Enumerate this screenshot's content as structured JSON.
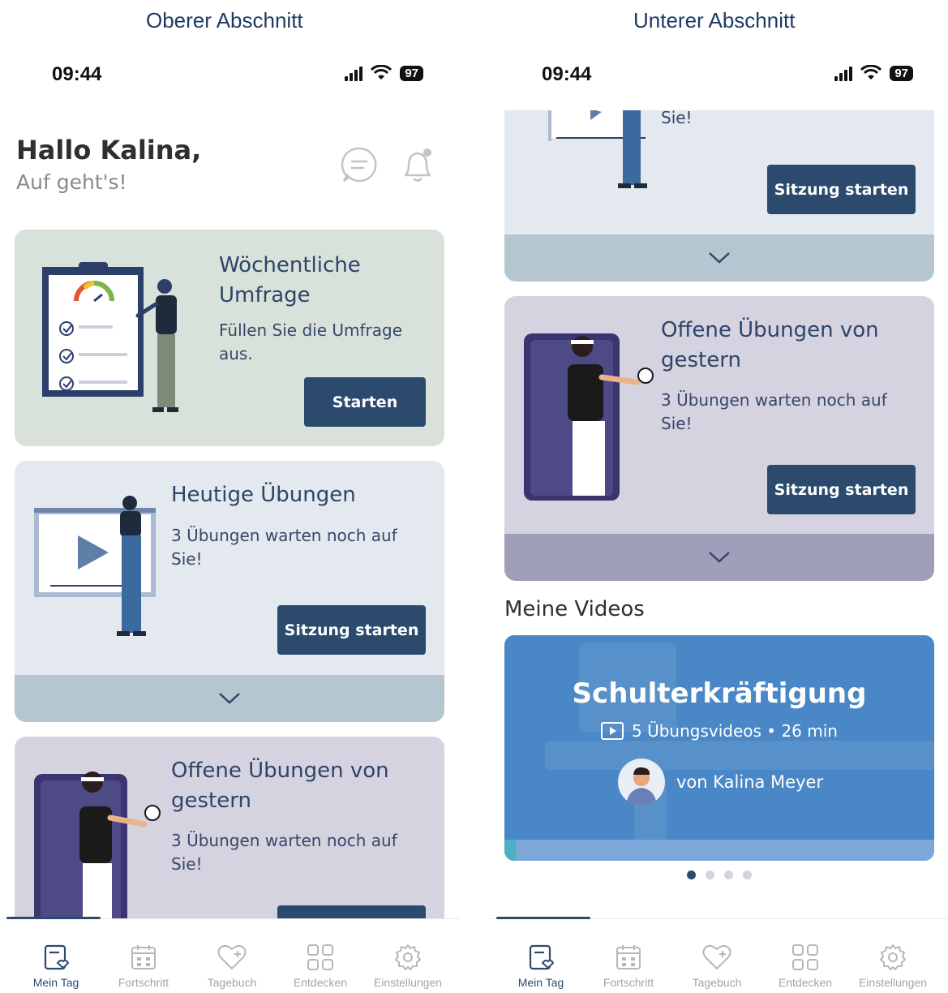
{
  "section_labels": {
    "left": "Oberer Abschnitt",
    "right": "Unterer Abschnitt"
  },
  "status": {
    "time": "09:44",
    "battery": "97"
  },
  "greeting": {
    "title": "Hallo Kalina,",
    "subtitle": "Auf geht's!"
  },
  "survey": {
    "title_line1": "Wöchentliche",
    "title_line2": "Umfrage",
    "desc_line1": "Füllen Sie die Umfrage",
    "desc_line2": "aus.",
    "button": "Starten"
  },
  "today": {
    "title": "Heutige Übungen",
    "desc_line1": "3 Übungen warten noch auf",
    "desc_line2": "Sie!",
    "button": "Sitzung starten"
  },
  "open": {
    "title_line1": "Offene Übungen von",
    "title_line2": "gestern",
    "desc_line1": "3 Übungen warten noch auf",
    "desc_line2": "Sie!",
    "button": "Sitzung starten"
  },
  "videos": {
    "section_title": "Meine Videos",
    "title": "Schulterkräftigung",
    "meta": "5 Übungsvideos • 26 min",
    "author": "von Kalina Meyer",
    "carousel_active": 1,
    "carousel_count": 4
  },
  "tabs": [
    {
      "label": "Mein Tag",
      "icon": "my-day-icon",
      "active": true
    },
    {
      "label": "Fortschritt",
      "icon": "calendar-icon",
      "active": false
    },
    {
      "label": "Tagebuch",
      "icon": "heart-plus-icon",
      "active": false
    },
    {
      "label": "Entdecken",
      "icon": "grid-icon",
      "active": false
    },
    {
      "label": "Einstellungen",
      "icon": "gear-icon",
      "active": false
    }
  ],
  "colors": {
    "accent": "#2c4a6e",
    "survey_bg": "#d9e2da",
    "exercise_bg": "#e3e9ee",
    "open_bg": "#d5d3e0",
    "video_bg": "#4a87c6"
  }
}
